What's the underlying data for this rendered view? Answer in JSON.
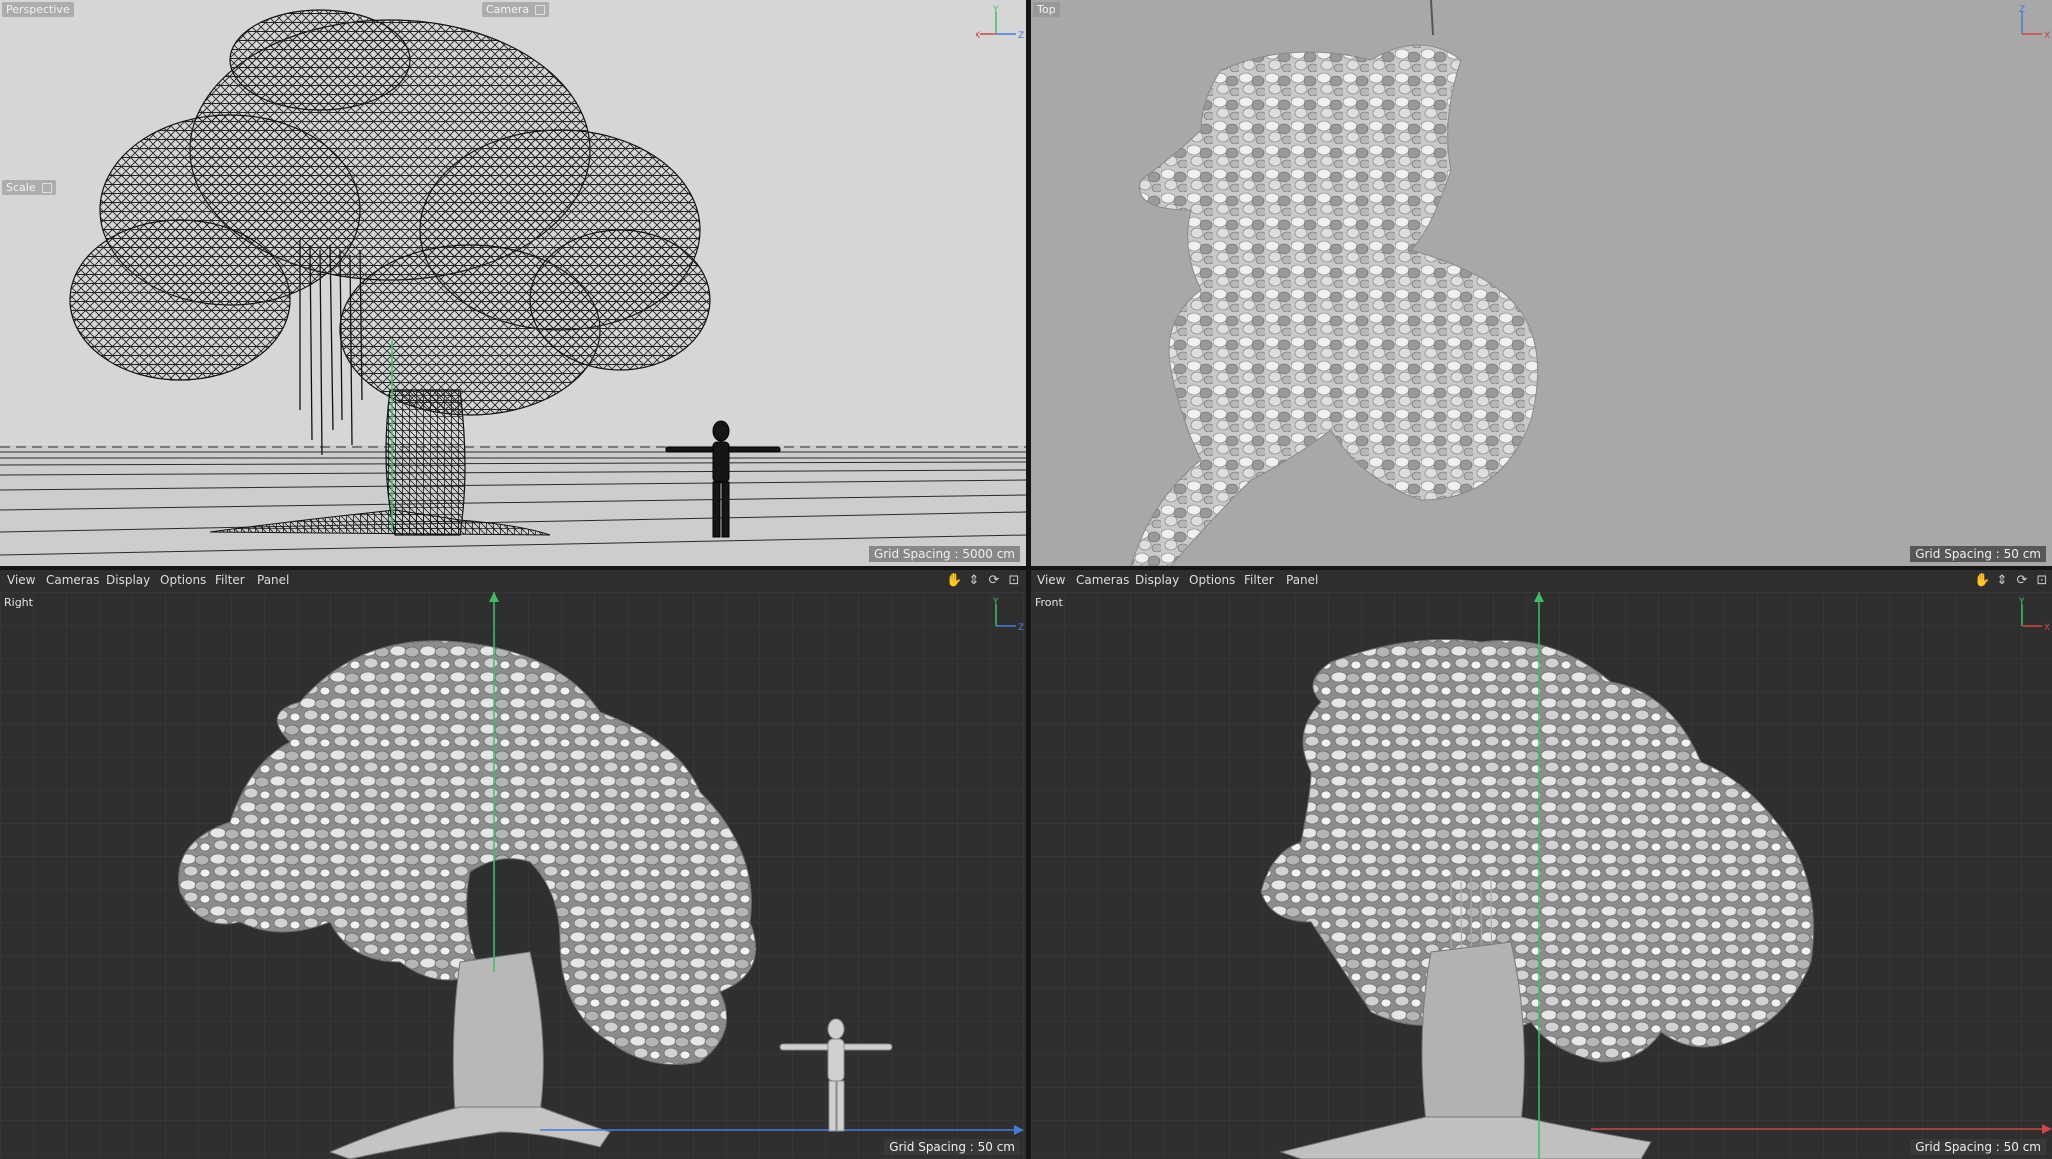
{
  "viewports": {
    "perspective": {
      "name": "Perspective",
      "camera_tag": "Camera",
      "scale_tag": "Scale",
      "grid_spacing": "Grid Spacing : 5000 cm",
      "bg": "#d8d8d8"
    },
    "top": {
      "name": "Top",
      "grid_spacing": "Grid Spacing : 50 cm",
      "bg": "#a9a9a9"
    },
    "right": {
      "name": "Right",
      "grid_spacing": "Grid Spacing : 50 cm",
      "bg": "#2f2f2f"
    },
    "front": {
      "name": "Front",
      "grid_spacing": "Grid Spacing : 50 cm",
      "bg": "#2f2f2f"
    }
  },
  "menu": {
    "view": "View",
    "cameras": "Cameras",
    "display": "Display",
    "options": "Options",
    "filter": "Filter",
    "panel": "Panel"
  },
  "axes": {
    "x": "X",
    "y": "Y",
    "z": "Z"
  },
  "colors": {
    "axis_x": "#d04545",
    "axis_y": "#3fc060",
    "axis_z": "#4a7ad8"
  },
  "icons": [
    "pan-hand-icon",
    "move-arrow-icon",
    "rotate-icon",
    "maximize-icon"
  ]
}
